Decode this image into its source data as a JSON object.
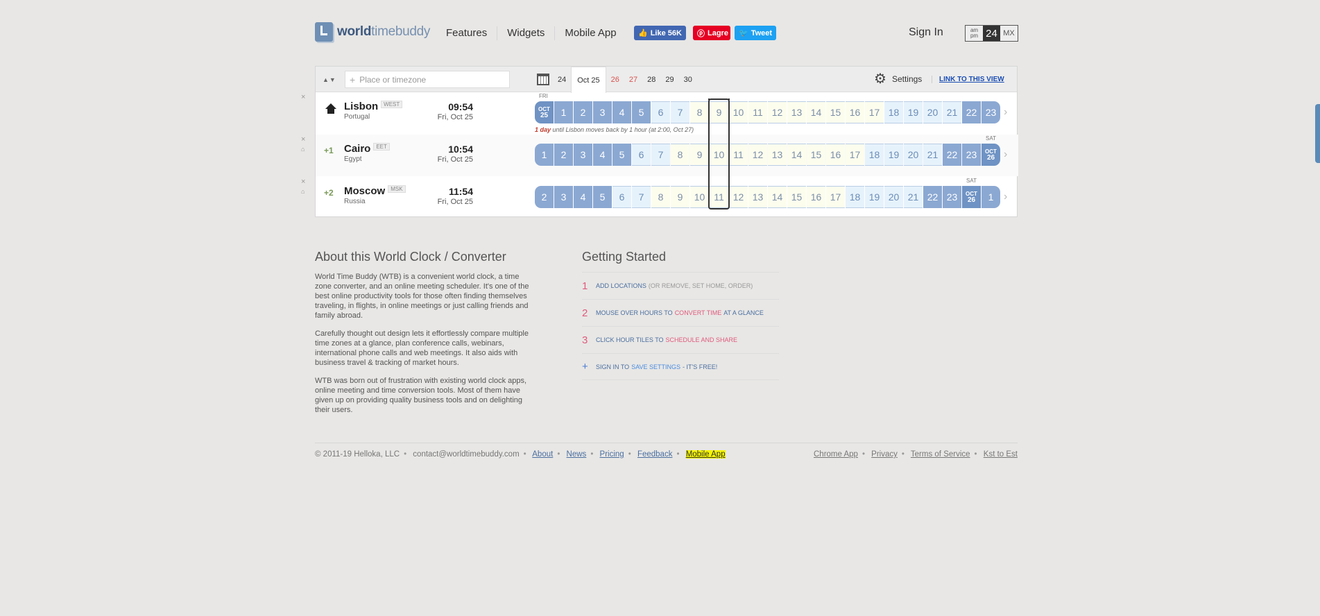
{
  "logo": {
    "bold": "world",
    "light": "timebuddy"
  },
  "nav": [
    "Features",
    "Widgets",
    "Mobile App"
  ],
  "social": {
    "fb": "Like 56K",
    "pin": "Lagre",
    "tw": "Tweet"
  },
  "signin": "Sign In",
  "time_format": {
    "ampm_top": "am",
    "ampm_bottom": "pm",
    "h24": "24",
    "mx": "MX"
  },
  "toolbar": {
    "search_placeholder": "Place or timezone",
    "days": [
      {
        "label": "24",
        "weekend": false
      },
      {
        "label": "Oct 25",
        "weekend": false,
        "today": true
      },
      {
        "label": "26",
        "weekend": true
      },
      {
        "label": "27",
        "weekend": true
      },
      {
        "label": "28",
        "weekend": false
      },
      {
        "label": "29",
        "weekend": false
      },
      {
        "label": "30",
        "weekend": false
      }
    ],
    "settings": "Settings",
    "link_view": "LINK TO THIS VIEW"
  },
  "locations": [
    {
      "city": "Lisbon",
      "abbr": "WEST",
      "country": "Portugal",
      "offset": "",
      "time": "09:54",
      "date": "Fri, Oct 25",
      "hours": [
        {
          "t": "date",
          "m": "OCT",
          "d": "25"
        },
        "1",
        "2",
        "3",
        "4",
        "5",
        "6",
        "7",
        "8",
        "9",
        "10",
        "11",
        "12",
        "13",
        "14",
        "15",
        "16",
        "17",
        "18",
        "19",
        "20",
        "21",
        "22",
        "23"
      ],
      "day_label": "FRI",
      "day_label_pos": 0,
      "note": {
        "bold": "1 day",
        "text": " until Lisbon moves back by 1 hour (at 2:00, Oct 27)"
      }
    },
    {
      "city": "Cairo",
      "abbr": "EET",
      "country": "Egypt",
      "offset": "+1",
      "time": "10:54",
      "date": "Fri, Oct 25",
      "hours": [
        "1",
        "2",
        "3",
        "4",
        "5",
        "6",
        "7",
        "8",
        "9",
        "10",
        "11",
        "12",
        "13",
        "14",
        "15",
        "16",
        "17",
        "18",
        "19",
        "20",
        "21",
        "22",
        "23",
        {
          "t": "date",
          "m": "OCT",
          "d": "26"
        }
      ],
      "day_label": "SAT",
      "day_label_pos": 23
    },
    {
      "city": "Moscow",
      "abbr": "MSK",
      "country": "Russia",
      "offset": "+2",
      "time": "11:54",
      "date": "Fri, Oct 25",
      "hours": [
        "2",
        "3",
        "4",
        "5",
        "6",
        "7",
        "8",
        "9",
        "10",
        "11",
        "12",
        "13",
        "14",
        "15",
        "16",
        "17",
        "18",
        "19",
        "20",
        "21",
        "22",
        "23",
        {
          "t": "date",
          "m": "OCT",
          "d": "26"
        },
        "1"
      ],
      "day_label": "SAT",
      "day_label_pos": 22
    }
  ],
  "about": {
    "title": "About this World Clock / Converter",
    "p1": "World Time Buddy (WTB) is a convenient world clock, a time zone converter, and an online meeting scheduler. It's one of the best online productivity tools for those often finding themselves traveling, in flights, in online meetings or just calling friends and family abroad.",
    "p2": "Carefully thought out design lets it effortlessly compare multiple time zones at a glance, plan conference calls, webinars, international phone calls and web meetings. It also aids with business travel & tracking of market hours.",
    "p3": "WTB was born out of frustration with existing world clock apps, online meeting and time conversion tools. Most of them have given up on providing quality business tools and on delighting their users."
  },
  "getting_started": {
    "title": "Getting Started",
    "s1": {
      "n": "1",
      "a": "ADD LOCATIONS",
      "b": "(OR REMOVE, SET HOME, ORDER)"
    },
    "s2": {
      "n": "2",
      "a": "MOUSE OVER HOURS TO",
      "b": "CONVERT TIME",
      "c": "AT A GLANCE"
    },
    "s3": {
      "n": "3",
      "a": "CLICK HOUR TILES TO",
      "b": "SCHEDULE AND SHARE"
    },
    "s4": {
      "n": "+",
      "a": "SIGN IN TO",
      "b": "SAVE SETTINGS",
      "c": "- IT'S FREE!"
    }
  },
  "footer": {
    "copyright": "© 2011-19 Helloka, LLC",
    "email": "contact@worldtimebuddy.com",
    "links_left": [
      "About",
      "News",
      "Pricing",
      "Feedback"
    ],
    "mobile_app": "Mobile App",
    "links_right": [
      "Chrome App",
      "Privacy",
      "Terms of Service",
      "Kst to Est"
    ]
  }
}
